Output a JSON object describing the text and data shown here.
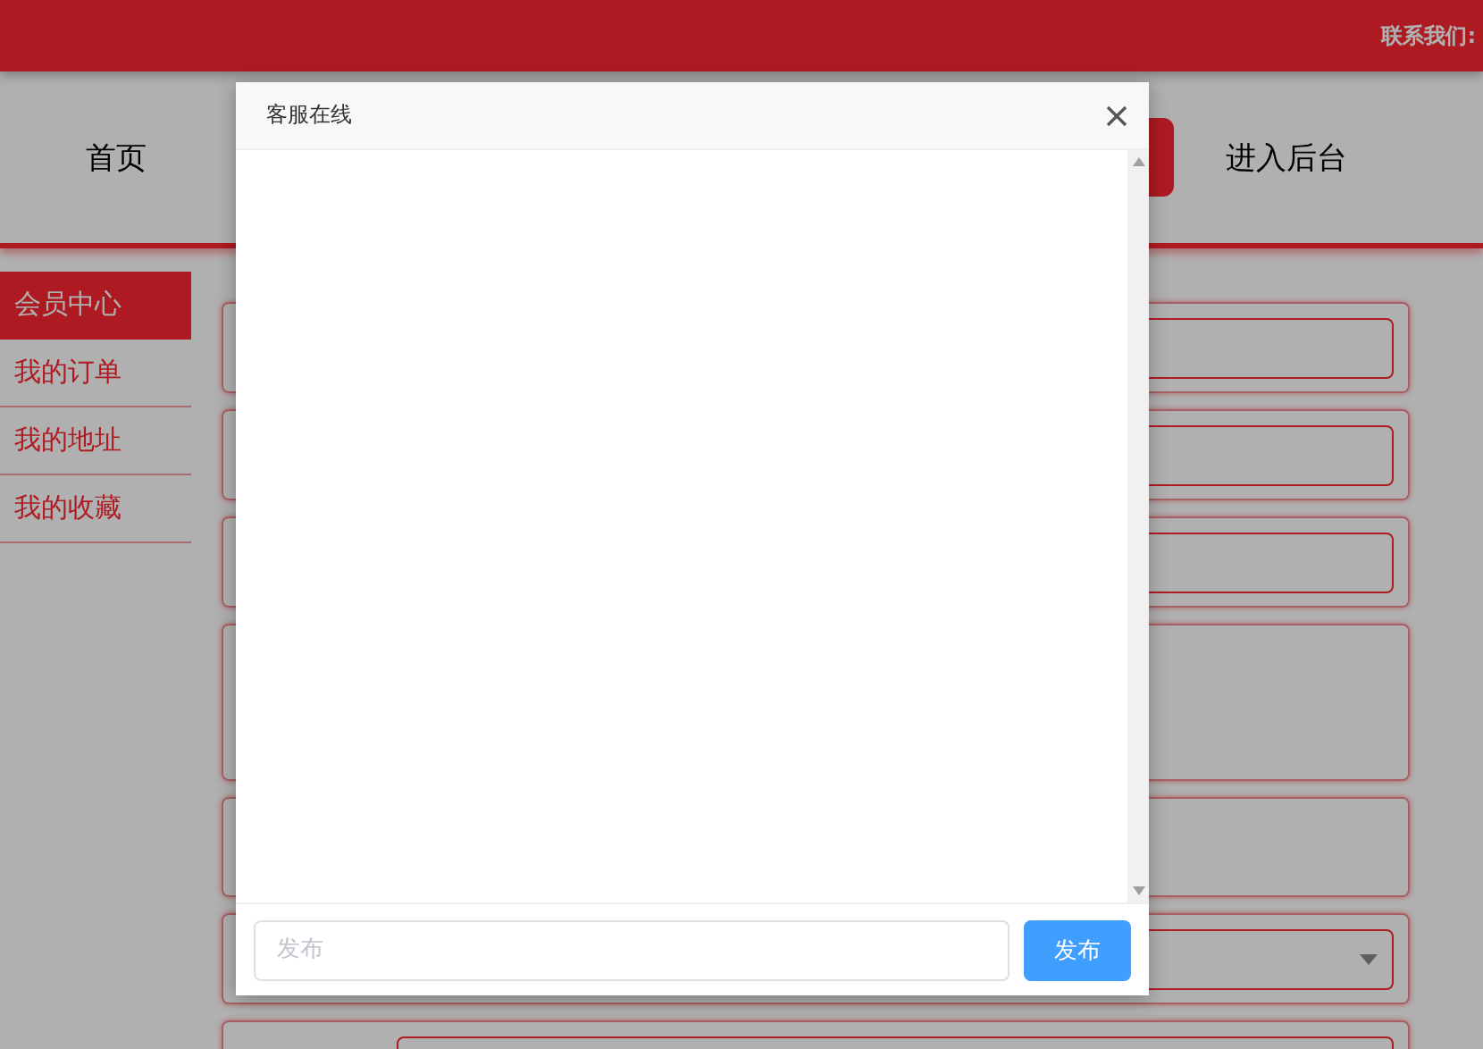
{
  "header": {
    "contact": "联系我们:"
  },
  "nav": [
    {
      "label": "首页",
      "selected": false
    },
    {
      "selected": true
    },
    {
      "label": "进入后台",
      "selected": false
    }
  ],
  "sidebar": [
    {
      "label": "会员中心",
      "selected": true
    },
    {
      "label": "我的订单",
      "selected": false
    },
    {
      "label": "我的地址",
      "selected": false
    },
    {
      "label": "我的收藏",
      "selected": false
    }
  ],
  "form_rows": [
    {
      "kind": "input"
    },
    {
      "kind": "input"
    },
    {
      "kind": "input"
    },
    {
      "kind": "blank",
      "tall": true
    },
    {
      "kind": "blank"
    },
    {
      "kind": "select"
    },
    {
      "kind": "wide-input"
    }
  ],
  "dialog": {
    "title": "客服在线",
    "input": {
      "placeholder": "发布"
    },
    "send_button": "发布"
  }
}
